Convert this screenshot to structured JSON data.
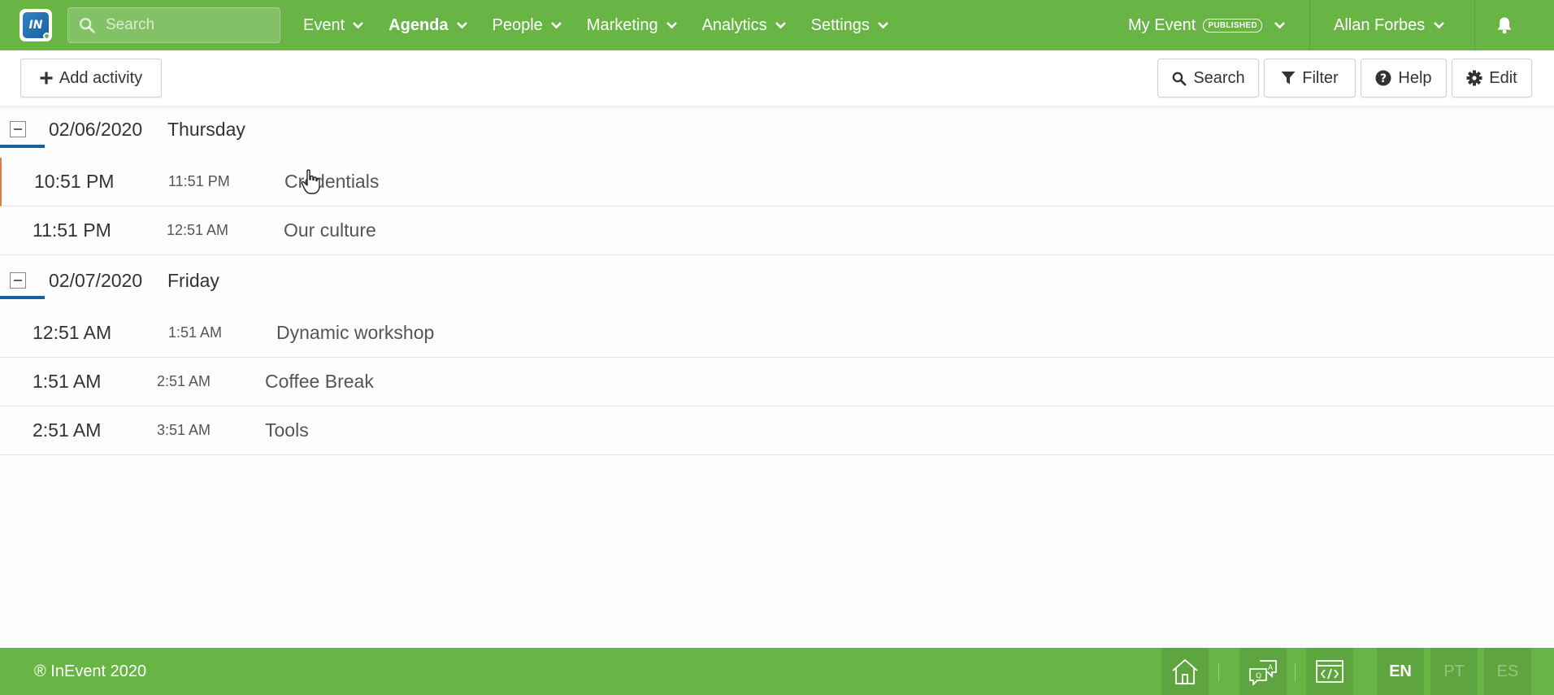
{
  "header": {
    "search_placeholder": "Search",
    "nav": [
      {
        "label": "Event",
        "active": false
      },
      {
        "label": "Agenda",
        "active": true
      },
      {
        "label": "People",
        "active": false
      },
      {
        "label": "Marketing",
        "active": false
      },
      {
        "label": "Analytics",
        "active": false
      },
      {
        "label": "Settings",
        "active": false
      }
    ],
    "event_name": "My Event",
    "event_status": "PUBLISHED",
    "user_name": "Allan Forbes"
  },
  "toolbar": {
    "add_label": "Add activity",
    "search_label": "Search",
    "filter_label": "Filter",
    "help_label": "Help",
    "edit_label": "Edit"
  },
  "agenda": {
    "days": [
      {
        "date": "02/06/2020",
        "weekday": "Thursday",
        "activities": [
          {
            "start": "10:51 PM",
            "end": "11:51 PM",
            "title": "Credentials"
          },
          {
            "start": "11:51 PM",
            "end": "12:51 AM",
            "title": "Our culture"
          }
        ]
      },
      {
        "date": "02/07/2020",
        "weekday": "Friday",
        "activities": [
          {
            "start": "12:51 AM",
            "end": "1:51 AM",
            "title": "Dynamic workshop"
          },
          {
            "start": "1:51 AM",
            "end": "2:51 AM",
            "title": "Coffee Break"
          },
          {
            "start": "2:51 AM",
            "end": "3:51 AM",
            "title": "Tools"
          }
        ]
      }
    ]
  },
  "footer": {
    "copyright": "® InEvent 2020",
    "languages": [
      "EN",
      "PT",
      "ES"
    ],
    "active_language": "EN"
  },
  "colors": {
    "brand_green": "#68b445",
    "accent_blue": "#1a5f96",
    "highlight_orange": "#d9804a"
  }
}
